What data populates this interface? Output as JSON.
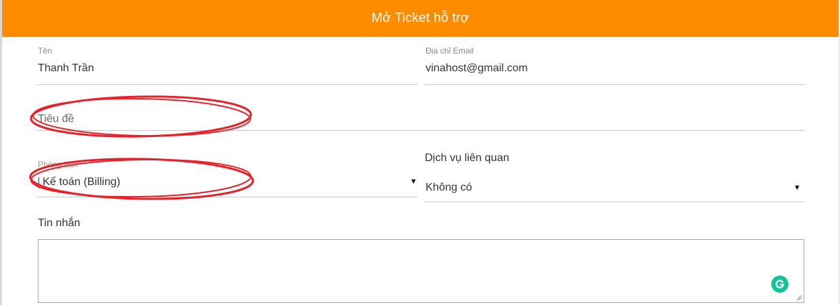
{
  "header": {
    "title": "Mở Ticket hỗ trợ"
  },
  "form": {
    "name": {
      "label": "Tên",
      "value": "Thanh Trần"
    },
    "email": {
      "label": "Địa chỉ Email",
      "value": "vinahost@gmail.com"
    },
    "subject": {
      "placeholder": "Tiêu đề"
    },
    "department": {
      "label": "Phòng ban",
      "selected": "Kế toán (Billing)"
    },
    "related_service": {
      "label": "Dịch vụ liên quan",
      "selected": "Không có"
    },
    "message": {
      "label": "Tin nhắn",
      "value": ""
    }
  },
  "icons": {
    "dropdown": "caret-down-icon",
    "grammarly": "grammarly-icon",
    "resize": "resize-grip-icon"
  },
  "colors": {
    "header_bg": "#ff8c00",
    "annotation": "#e8202a",
    "textarea_border": "#e0a020",
    "grammarly": "#15c39a"
  }
}
